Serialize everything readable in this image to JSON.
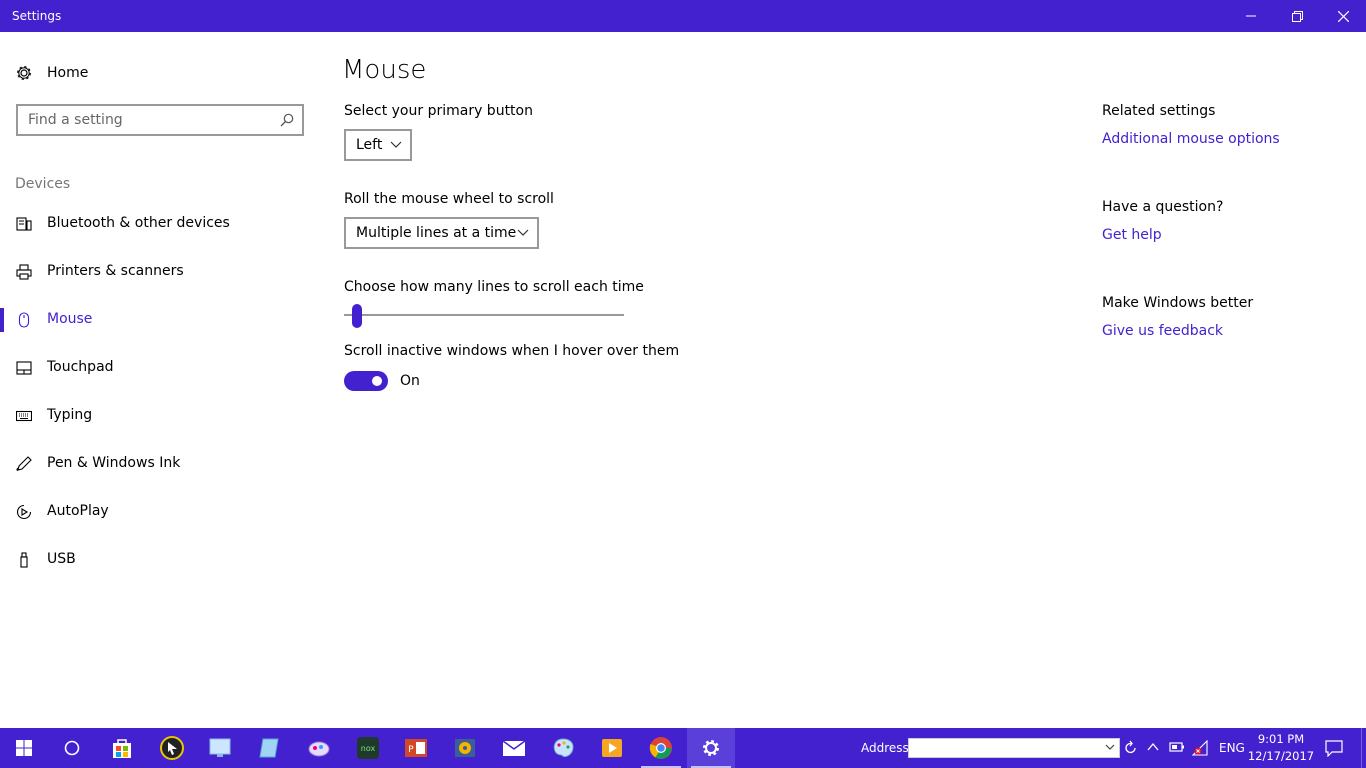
{
  "window": {
    "title": "Settings",
    "accent": "#4321cf"
  },
  "sidebar": {
    "home_label": "Home",
    "search_placeholder": "Find a setting",
    "section_label": "Devices",
    "items": [
      {
        "label": "Bluetooth & other devices",
        "icon": "bluetooth-devices-icon"
      },
      {
        "label": "Printers & scanners",
        "icon": "printer-icon"
      },
      {
        "label": "Mouse",
        "icon": "mouse-icon",
        "active": true
      },
      {
        "label": "Touchpad",
        "icon": "touchpad-icon"
      },
      {
        "label": "Typing",
        "icon": "keyboard-icon"
      },
      {
        "label": "Pen & Windows Ink",
        "icon": "pen-icon"
      },
      {
        "label": "AutoPlay",
        "icon": "autoplay-icon"
      },
      {
        "label": "USB",
        "icon": "usb-icon"
      }
    ]
  },
  "main": {
    "title": "Mouse",
    "primary_button_label": "Select your primary button",
    "primary_button_value": "Left",
    "wheel_label": "Roll the mouse wheel to scroll",
    "wheel_value": "Multiple lines at a time",
    "lines_label": "Choose how many lines to scroll each time",
    "lines_fraction": 0.02,
    "inactive_label": "Scroll inactive windows when I hover over them",
    "inactive_state": "On"
  },
  "related": {
    "heading": "Related settings",
    "link": "Additional mouse options",
    "question_heading": "Have a question?",
    "question_link": "Get help",
    "better_heading": "Make Windows better",
    "better_link": "Give us feedback"
  },
  "taskbar": {
    "address_label": "Address",
    "address_value": "",
    "language": "ENG",
    "time": "9:01 PM",
    "date": "12/17/2017"
  }
}
